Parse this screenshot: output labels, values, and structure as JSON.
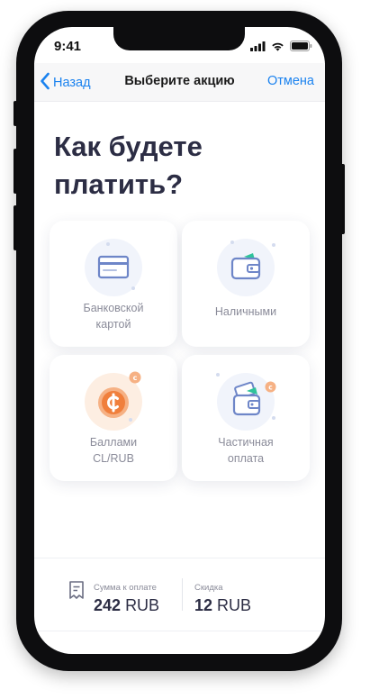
{
  "status_bar": {
    "time": "9:41"
  },
  "nav": {
    "back_label": "Назад",
    "title": "Выберите акцию",
    "cancel_label": "Отмена"
  },
  "heading": "Как будете платить?",
  "payment_options": [
    {
      "line1": "Банковской",
      "line2": "картой",
      "icon": "credit-card-icon"
    },
    {
      "line1": "Наличными",
      "line2": "",
      "icon": "wallet-icon"
    },
    {
      "line1": "Баллами",
      "line2": "CL/RUB",
      "icon": "coin-icon"
    },
    {
      "line1": "Частичная",
      "line2": "оплата",
      "icon": "wallet-cards-icon"
    }
  ],
  "summary": {
    "amount_caption": "Сумма к оплате",
    "amount_number": "242",
    "amount_currency": "RUB",
    "discount_caption": "Скидка",
    "discount_number": "12",
    "discount_currency": "RUB"
  },
  "colors": {
    "accent": "#1a82ef",
    "heading": "#2c2d44",
    "muted": "#8a8b99",
    "orange": "#f07f3c",
    "green": "#2fc39a"
  }
}
